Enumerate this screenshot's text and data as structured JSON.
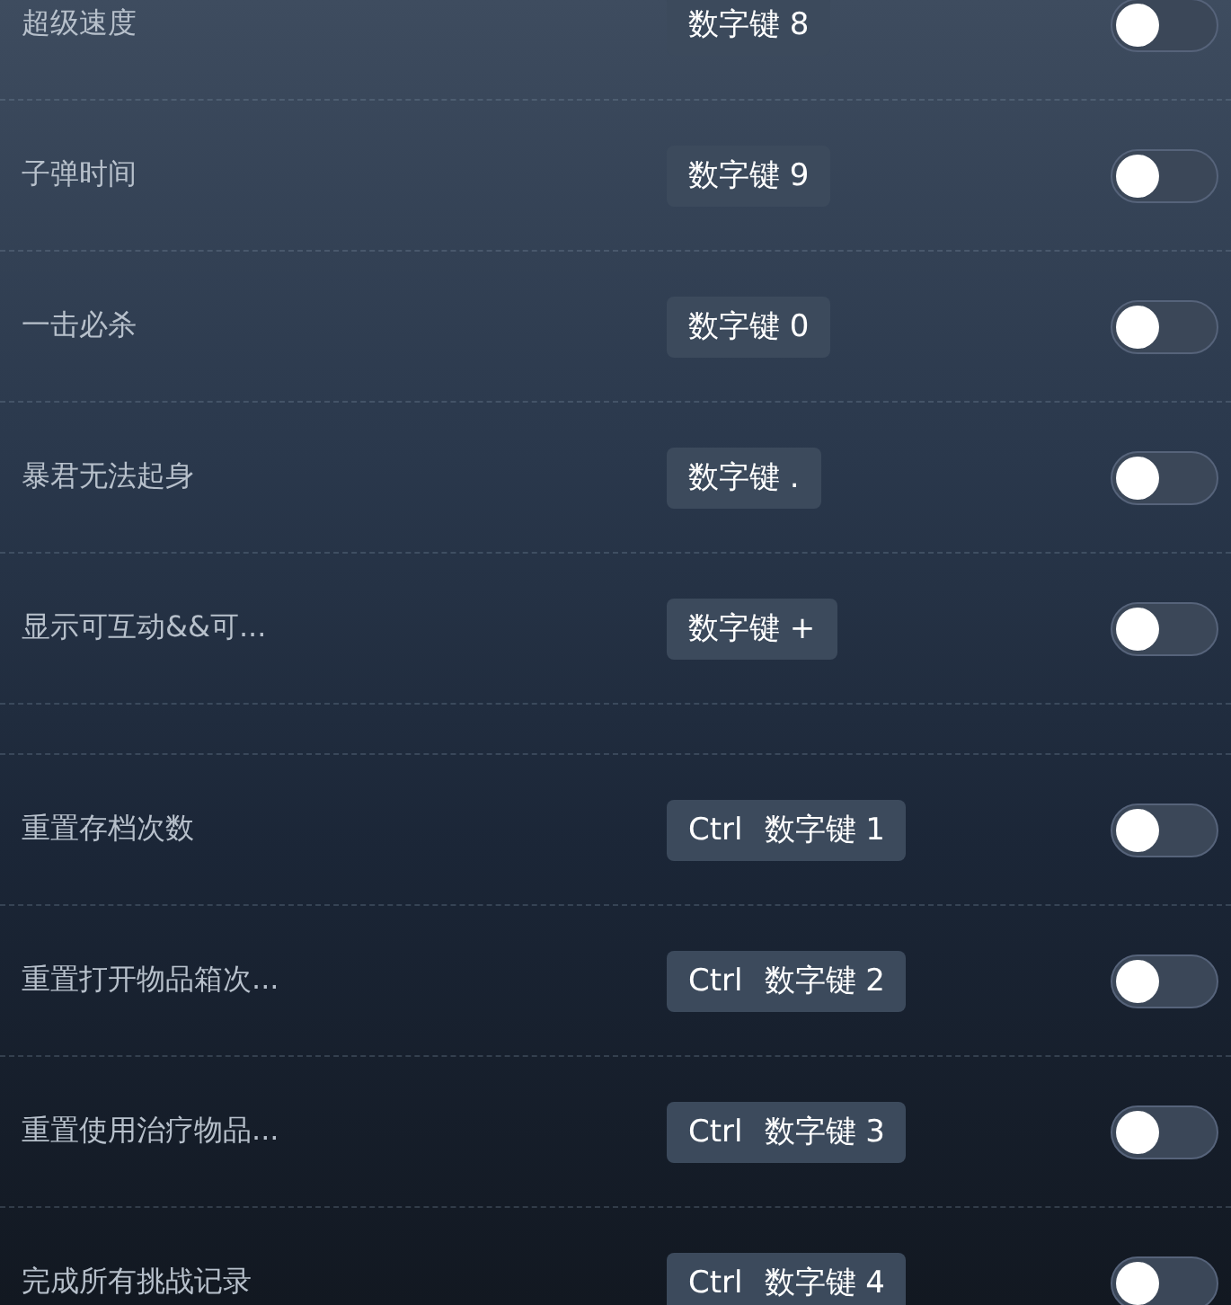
{
  "rows": [
    {
      "kind": "item",
      "label": "超级速度",
      "keys": [
        "数字键 8"
      ],
      "on": false
    },
    {
      "kind": "item",
      "label": "子弹时间",
      "keys": [
        "数字键 9"
      ],
      "on": false
    },
    {
      "kind": "item",
      "label": "一击必杀",
      "keys": [
        "数字键 0"
      ],
      "on": false
    },
    {
      "kind": "item",
      "label": "暴君无法起身",
      "keys": [
        "数字键 ."
      ],
      "on": false
    },
    {
      "kind": "item",
      "label": "显示可互动&&可...",
      "keys": [
        "数字键 +"
      ],
      "on": false
    },
    {
      "kind": "spacer"
    },
    {
      "kind": "item",
      "label": "重置存档次数",
      "keys": [
        "Ctrl",
        "数字键 1"
      ],
      "on": false
    },
    {
      "kind": "item",
      "label": "重置打开物品箱次...",
      "keys": [
        "Ctrl",
        "数字键 2"
      ],
      "on": false
    },
    {
      "kind": "item",
      "label": "重置使用治疗物品...",
      "keys": [
        "Ctrl",
        "数字键 3"
      ],
      "on": false
    },
    {
      "kind": "item",
      "label": "完成所有挑战记录",
      "keys": [
        "Ctrl",
        "数字键 4"
      ],
      "on": false
    }
  ]
}
